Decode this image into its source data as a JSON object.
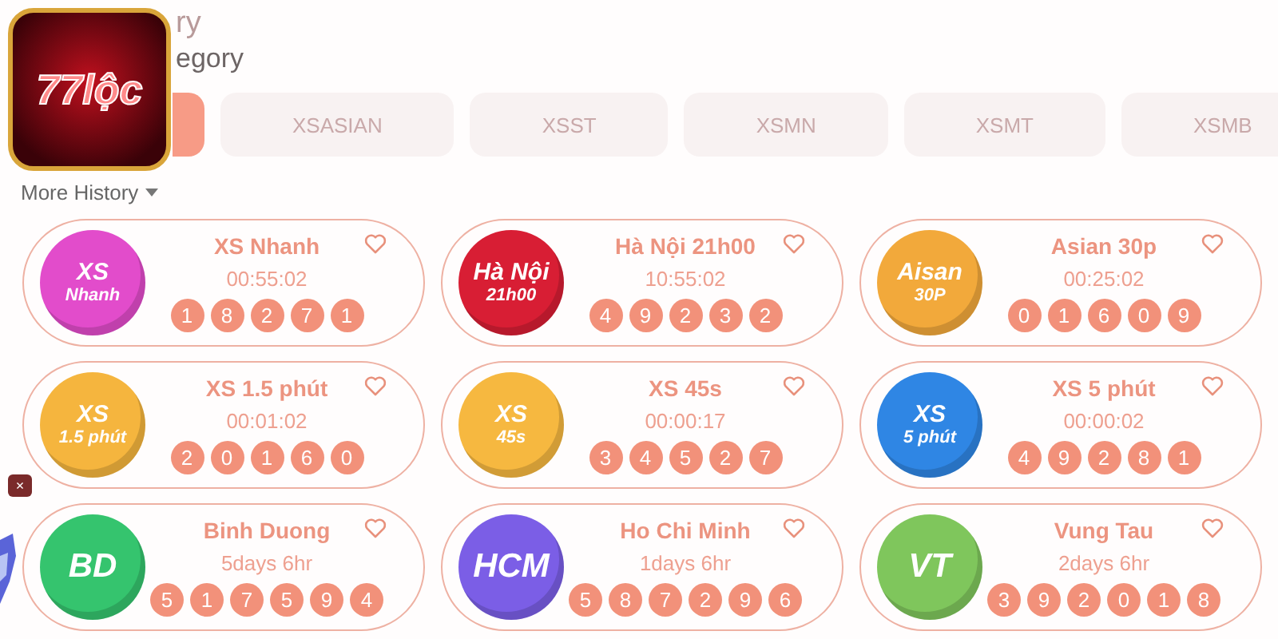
{
  "logo": {
    "text": "77lộc"
  },
  "heading": {
    "title": "ry",
    "subtitle": "egory"
  },
  "tabs": [
    {
      "selected": true
    },
    {
      "label": "XSASIAN",
      "selected": false
    },
    {
      "label": "XSST",
      "selected": false
    },
    {
      "label": "XSMN",
      "selected": false
    },
    {
      "label": "XSMT",
      "selected": false
    },
    {
      "label": "XSMB",
      "selected": false
    }
  ],
  "more_history": {
    "label": "More History"
  },
  "close_badge": {
    "label": "×"
  },
  "games": [
    {
      "name": "XS Nhanh",
      "badge_lines": [
        "XS",
        "Nhanh"
      ],
      "color": "#e24ccb",
      "time": "00:55:02",
      "numbers": [
        "1",
        "8",
        "2",
        "7",
        "1"
      ]
    },
    {
      "name": "Hà Nội 21h00",
      "badge_lines": [
        "Hà Nội",
        "21h00"
      ],
      "color": "#d81e34",
      "time": "10:55:02",
      "numbers": [
        "4",
        "9",
        "2",
        "3",
        "2"
      ]
    },
    {
      "name": "Asian 30p",
      "badge_lines": [
        "Aisan",
        "30P"
      ],
      "color": "#f2a93b",
      "time": "00:25:02",
      "numbers": [
        "0",
        "1",
        "6",
        "0",
        "9"
      ]
    },
    {
      "name": "XS 1.5 phút",
      "badge_lines": [
        "XS",
        "1.5 phút"
      ],
      "color": "#f5b53e",
      "time": "00:01:02",
      "numbers": [
        "2",
        "0",
        "1",
        "6",
        "0"
      ]
    },
    {
      "name": "XS 45s",
      "badge_lines": [
        "XS",
        "45s"
      ],
      "color": "#f6b840",
      "time": "00:00:17",
      "numbers": [
        "3",
        "4",
        "5",
        "2",
        "7"
      ]
    },
    {
      "name": "XS 5 phút",
      "badge_lines": [
        "XS",
        "5 phút"
      ],
      "color": "#2f86e4",
      "time": "00:00:02",
      "numbers": [
        "4",
        "9",
        "2",
        "8",
        "1"
      ]
    },
    {
      "name": "Binh Duong",
      "badge_lines": [
        "BD"
      ],
      "color": "#35c46e",
      "time": "5days 6hr",
      "numbers": [
        "5",
        "1",
        "7",
        "5",
        "9",
        "4"
      ]
    },
    {
      "name": "Ho Chi Minh",
      "badge_lines": [
        "HCM"
      ],
      "color": "#7b5ee6",
      "time": "1days 6hr",
      "numbers": [
        "5",
        "8",
        "7",
        "2",
        "9",
        "6"
      ]
    },
    {
      "name": "Vung Tau",
      "badge_lines": [
        "VT"
      ],
      "color": "#7fc65c",
      "time": "2days 6hr",
      "numbers": [
        "3",
        "9",
        "2",
        "0",
        "1",
        "8"
      ]
    }
  ]
}
